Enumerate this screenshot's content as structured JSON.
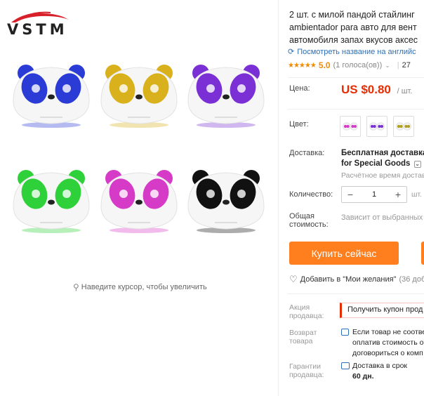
{
  "brand": {
    "logo_text": "VSTM"
  },
  "gallery": {
    "products": [
      {
        "color": "#2a3bd6",
        "label": "blue"
      },
      {
        "color": "#d8b11c",
        "label": "yellow"
      },
      {
        "color": "#7a30d4",
        "label": "purple"
      },
      {
        "color": "#2fd13a",
        "label": "green"
      },
      {
        "color": "#d63bc7",
        "label": "pink"
      },
      {
        "color": "#111111",
        "label": "black"
      }
    ],
    "zoom_hint": "Наведите курсор, чтобы увеличить"
  },
  "product": {
    "title_lines": [
      "2 шт. с милой пандой стайлинг",
      "ambientador para авто для вент",
      "автомобиля запах вкусов аксес"
    ],
    "translate_link": "Посмотреть название на английс",
    "rating": {
      "stars": "★★★★★",
      "score": "5.0",
      "votes": "(1 голоса(ов))",
      "orders": "27"
    },
    "price": {
      "label": "Цена:",
      "value": "US $0.80",
      "unit": "/ шт."
    },
    "color": {
      "label": "Цвет:",
      "swatches": [
        "#d63bc7",
        "#7a30d4",
        "#b0a020"
      ]
    },
    "shipping": {
      "label": "Доставка:",
      "line1": "Бесплатная доставка в",
      "line2": "for Special Goods",
      "eta": "Расчётное время достав"
    },
    "quantity": {
      "label": "Количество:",
      "value": "1",
      "minus": "−",
      "plus": "+",
      "unit": "шт. (2"
    },
    "total": {
      "label_line1": "Общая",
      "label_line2": "стоимость:",
      "value": "Зависит от выбранных з"
    },
    "buy_button": "Купить сейчас",
    "wishlist": {
      "label": "Добавить в \"Мои желания\"",
      "count": "(36 доб"
    },
    "seller_promo": {
      "label_line1": "Акция",
      "label_line2": "продавца:",
      "text": "Получить купон прод"
    },
    "returns": {
      "label_line1": "Возврат",
      "label_line2": "товара",
      "lines": [
        "Если товар не соотве",
        "оплатив стоимость о",
        "договориться о комп"
      ]
    },
    "guarantee": {
      "label_line1": "Гарантии",
      "label_line2": "продавца:",
      "line1": "Доставка в срок",
      "line2": "60 дн."
    }
  },
  "colors": {
    "accent": "#ff7f1f",
    "price": "#e62e04",
    "link": "#2f6fb4",
    "star": "#f28b00"
  }
}
